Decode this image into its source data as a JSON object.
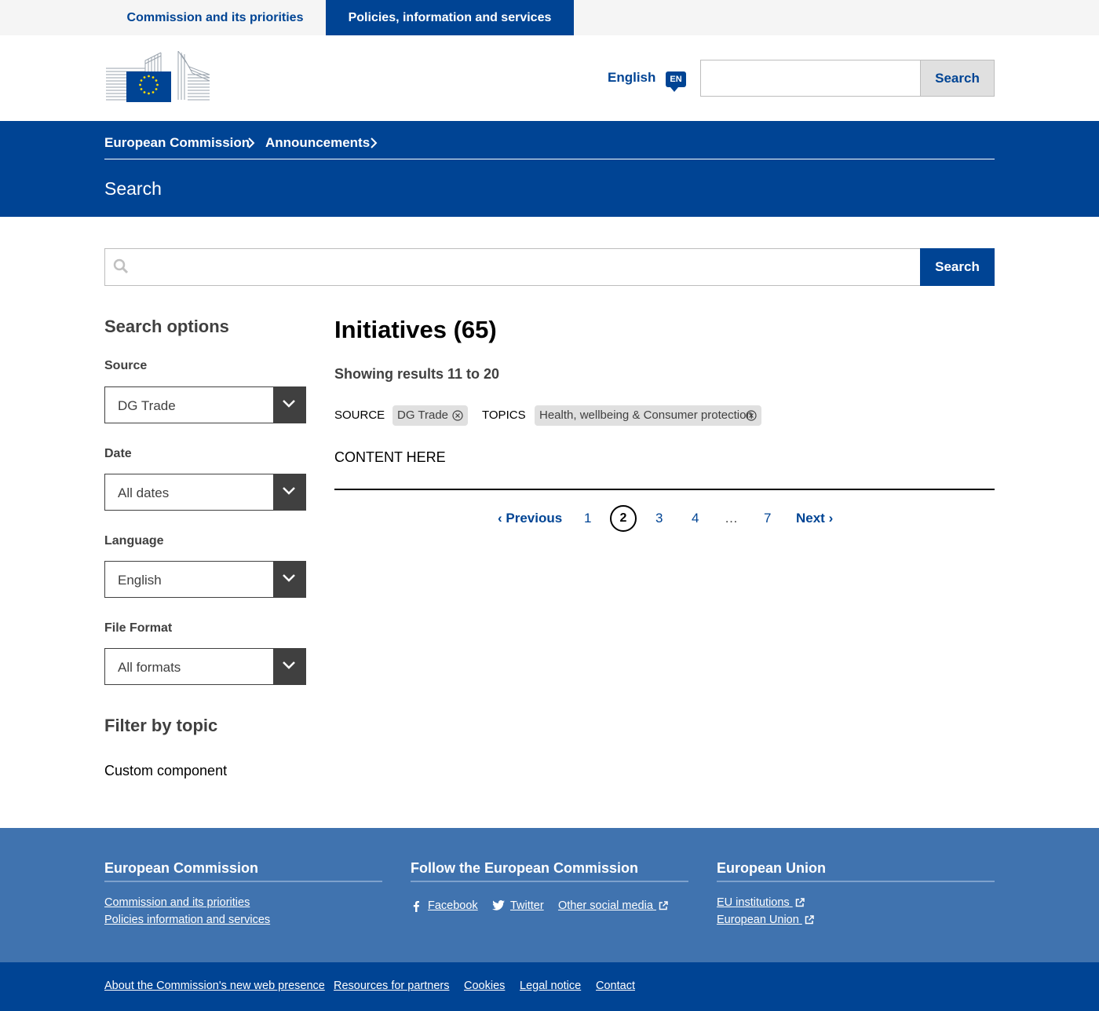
{
  "topnav": {
    "tab_commission": "Commission and its priorities",
    "tab_policies": "Policies, information and services"
  },
  "header": {
    "language": "English",
    "language_code": "EN",
    "search_button": "Search",
    "search_value": ""
  },
  "breadcrumb": {
    "items": [
      "European Commission",
      "Announcements"
    ]
  },
  "page_title": "Search",
  "main_search": {
    "value": "",
    "button": "Search"
  },
  "sidebar": {
    "title": "Search options",
    "filters": [
      {
        "label": "Source",
        "value": "DG Trade"
      },
      {
        "label": "Date",
        "value": "All dates"
      },
      {
        "label": "Language",
        "value": "English"
      },
      {
        "label": "File Format",
        "value": "All formats"
      }
    ],
    "topic_title": "Filter by topic",
    "custom_component": "Custom component"
  },
  "results": {
    "title": "Initiatives (65)",
    "showing": "Showing results 11 to 20",
    "source_label": "SOURCE",
    "source_chip": "DG Trade",
    "topics_label": "TOPICS",
    "topics_chip": "Health, wellbeing & Consumer protection",
    "content": "CONTENT HERE"
  },
  "pagination": {
    "previous": "‹ Previous",
    "pages": [
      "1",
      "2",
      "3",
      "4"
    ],
    "ellipsis": "…",
    "last": "7",
    "next": "Next ›",
    "current": "2"
  },
  "footer": {
    "col1": {
      "title": "European Commission",
      "links": [
        "Commission and its priorities",
        "Policies information and services"
      ]
    },
    "col2": {
      "title": "Follow the European Commission",
      "links": [
        "Facebook",
        "Twitter",
        "Other social media"
      ]
    },
    "col3": {
      "title": "European Union",
      "links": [
        "EU institutions",
        "European Union"
      ]
    },
    "bottom_links": [
      "About the Commission's new web presence",
      "Resources for partners",
      "Cookies",
      "Legal notice",
      "Contact"
    ]
  },
  "colors": {
    "primary": "#004494",
    "footer": "#4073af",
    "chip": "#e0e0e0",
    "dark": "#404040"
  }
}
